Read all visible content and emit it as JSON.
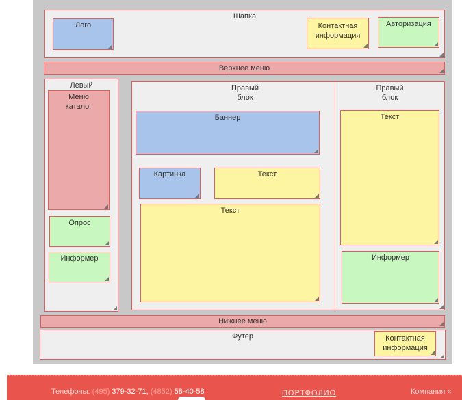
{
  "layout": {
    "header": "Шапка",
    "logo": "Лого",
    "contact_info": "Контактная информация",
    "authorization": "Авторизация",
    "top_menu": "Верхнее меню",
    "left_block": "Левый",
    "menu_catalog": "Меню каталог",
    "poll": "Опрос",
    "informer_left": "Информер",
    "center_block": "Правый блок",
    "banner": "Баннер",
    "picture": "Картинка",
    "text_small": "Текст",
    "text_large": "Текст",
    "right_block": "Правый блок",
    "right_text": "Текст",
    "informer_right": "Информер",
    "bottom_menu": "Нижнее меню",
    "footer": "Футер",
    "footer_contact_info": "Контактная информация"
  },
  "colors": {
    "frame": "#c8c8c8",
    "grey": "#efefef",
    "pink": "#eba9a9",
    "blue": "#a9c4ea",
    "yellow": "#fdf5a2",
    "green": "#c9f7c0",
    "border": "#e55a5a",
    "footer_bar": "#e9554c"
  },
  "footer_bar": {
    "phones_label": "Телефоны:",
    "code1": "(495)",
    "number1": "379-32-71,",
    "code2": "(4852)",
    "number2": "58-40-58",
    "portfolio": "ПОРТФОЛИО",
    "company": "Компания «"
  }
}
